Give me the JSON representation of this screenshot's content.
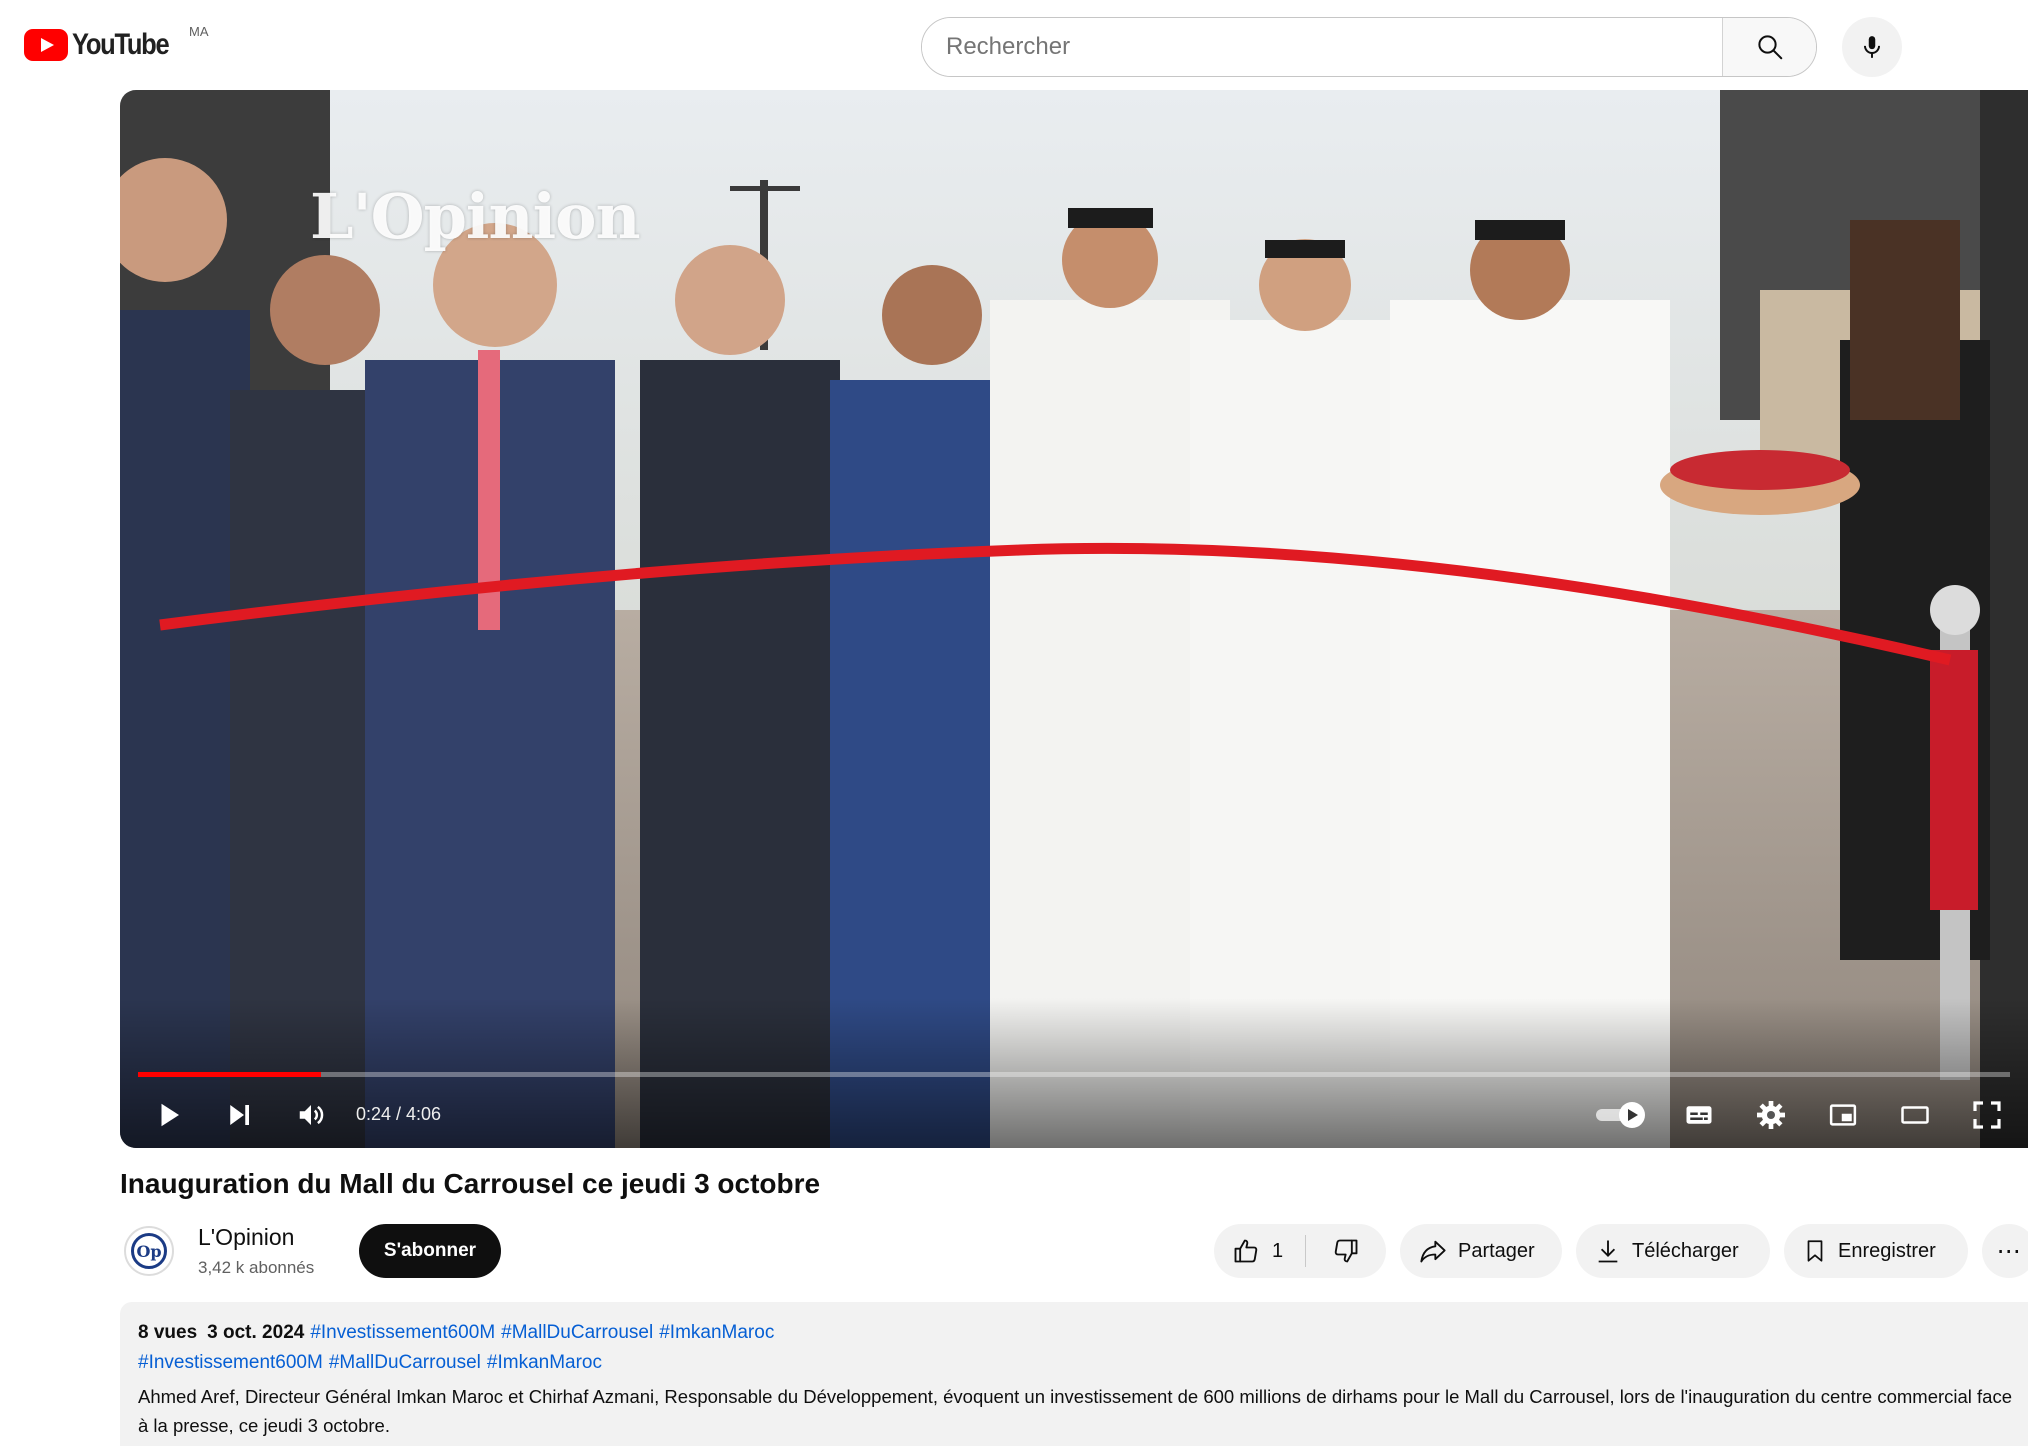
{
  "header": {
    "logo_text": "YouTube",
    "region": "MA",
    "search_placeholder": "Rechercher"
  },
  "player": {
    "watermark": "L'Opinion",
    "current_time": "0:24",
    "duration": "4:06",
    "time_display": "0:24 / 4:06",
    "progress_fraction": 0.0976,
    "colors": {
      "progress": "#ff0000",
      "ribbon": "#e01a22"
    }
  },
  "video": {
    "title": "Inauguration du Mall du Carrousel ce jeudi 3 octobre"
  },
  "channel": {
    "avatar_text": "Op",
    "name": "L'Opinion",
    "subscribers": "3,42 k abonnés",
    "subscribe_label": "S'abonner"
  },
  "actions": {
    "like_count": "1",
    "share_label": "Partager",
    "download_label": "Télécharger",
    "save_label": "Enregistrer",
    "more_label": "⋯"
  },
  "description": {
    "views": "8 vues",
    "date": "3 oct. 2024",
    "meta_tags": [
      "#Investissement600M",
      "#MallDuCarrousel",
      "#ImkanMaroc"
    ],
    "tags": [
      "#Investissement600M",
      "#MallDuCarrousel",
      "#ImkanMaroc"
    ],
    "text": "Ahmed Aref, Directeur Général Imkan Maroc et Chirhaf Azmani, Responsable du Développement, évoquent un investissement de 600 millions de dirhams pour le Mall du Carrousel, lors de l'inauguration du centre commercial face à la presse, ce jeudi 3 octobre."
  }
}
